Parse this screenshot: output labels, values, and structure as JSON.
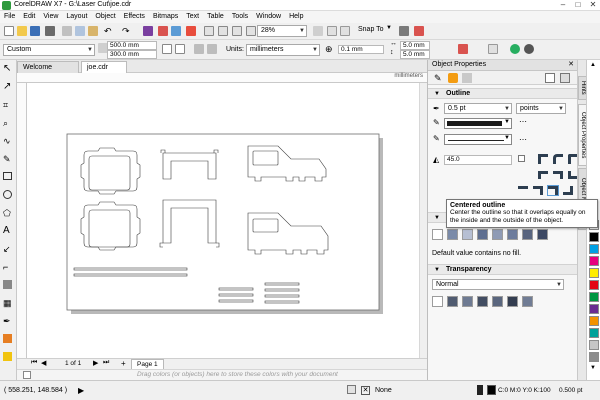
{
  "window": {
    "title": "CorelDRAW X7 - G:\\Laser Cut\\joe.cdr",
    "controls": [
      "minimize-icon",
      "maximize-icon",
      "close-icon"
    ]
  },
  "menu": [
    "File",
    "Edit",
    "View",
    "Layout",
    "Object",
    "Effects",
    "Bitmaps",
    "Text",
    "Table",
    "Tools",
    "Window",
    "Help"
  ],
  "standard_toolbar": {
    "zoom": "28%",
    "snap_to": "Snap To"
  },
  "property_bar": {
    "page_preset": "Custom",
    "page_width": "500.0 mm",
    "page_height": "300.0 mm",
    "units_label": "Units:",
    "units": "millimeters",
    "nudge": "0.1 mm",
    "dup_x": "5.0 mm",
    "dup_y": "5.0 mm"
  },
  "tabs": {
    "welcome": "Welcome Screen",
    "doc": "joe.cdr"
  },
  "ruler_unit": "millimeters",
  "page_nav": {
    "counter": "1 of 1",
    "page_tab": "Page 1"
  },
  "palette_hint": "Drag colors (or objects) here to store these colors with your document",
  "status": {
    "coords": "( 558.251, 148.584 )",
    "fill_none": "None",
    "outline_color": "C:0 M:0 Y:0 K:100",
    "outline_width": "0.500 pt"
  },
  "docker": {
    "title": "Object Properties",
    "outline": {
      "header": "Outline",
      "width": "0.5 pt",
      "width_units": "points",
      "miter": "45.0",
      "color": "#1a1a1a"
    },
    "tooltip": {
      "title": "Centered outline",
      "body": "Center the outline so that it overlaps equally on the inside and the outside of the object."
    },
    "fill_note": "Default value contains no fill.",
    "transparency": {
      "header": "Transparency",
      "mode": "Normal"
    }
  },
  "side_tabs": [
    "Hints",
    "Object Properties",
    "Object Manager"
  ],
  "palette_colors": [
    "#ffffff",
    "#000000",
    "#00a0e3",
    "#e6007e",
    "#ffed00",
    "#e30613",
    "#009640",
    "#6a2c90",
    "#f39200",
    "#00a19a",
    "#c6c6c6",
    "#8c8c8c"
  ]
}
